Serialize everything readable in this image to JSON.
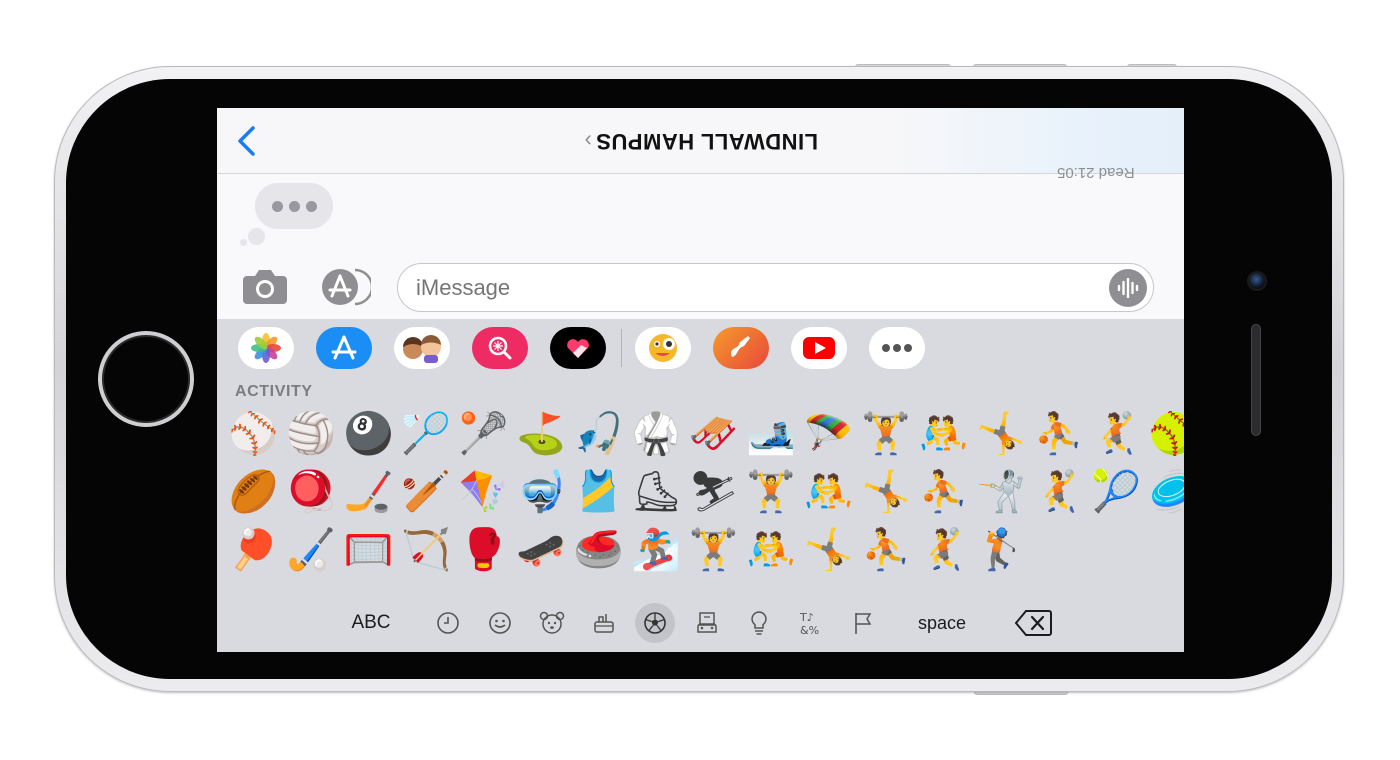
{
  "nav": {
    "contact_name": "LINDWALL HAMPUS",
    "contact_chevron": "›",
    "read_receipt": "Read 21:05"
  },
  "input": {
    "placeholder": "iMessage"
  },
  "app_drawer": {
    "apps": [
      "photos-icon",
      "app-store-icon",
      "memoji-icon",
      "image-search-icon",
      "digital-touch-icon",
      "sticker-icon",
      "music-app-icon",
      "youtube-icon",
      "more-icon"
    ]
  },
  "emoji_panel": {
    "section_label": "ACTIVITY",
    "rows": [
      [
        "⚾",
        "🏐",
        "🎱",
        "🏸",
        "🥍",
        "⛳",
        "🎣",
        "🥋",
        "🛷",
        "🎿",
        "🪂",
        "🏋",
        "🤼",
        "🤸",
        "⛹",
        "🤾"
      ],
      [
        "🥎",
        "🏉",
        "🪀",
        "🏒",
        "🏏",
        "🪁",
        "🤿",
        "🎽",
        "⛸",
        "⛷",
        "🏋",
        "🤼",
        "🤸",
        "⛹",
        "🤺",
        "🤾"
      ],
      [
        "🎾",
        "🥏",
        "🏓",
        "🏑",
        "🥅",
        "🏹",
        "🥊",
        "🛹",
        "🥌",
        "🏂",
        "🏋",
        "🤼",
        "🤸",
        "⛹",
        "🤾",
        "🏌"
      ]
    ]
  },
  "category_bar": {
    "abc_label": "ABC",
    "space_label": "space",
    "categories": [
      "recent-icon",
      "smileys-icon",
      "animals-icon",
      "food-icon",
      "activity-icon",
      "travel-icon",
      "objects-icon",
      "symbols-icon",
      "flags-icon"
    ],
    "active_category": "activity-icon"
  },
  "colors": {
    "ios_blue": "#1a7cf5",
    "youtube_red": "#ff0000",
    "keyboard_bg": "#d8dadf"
  }
}
